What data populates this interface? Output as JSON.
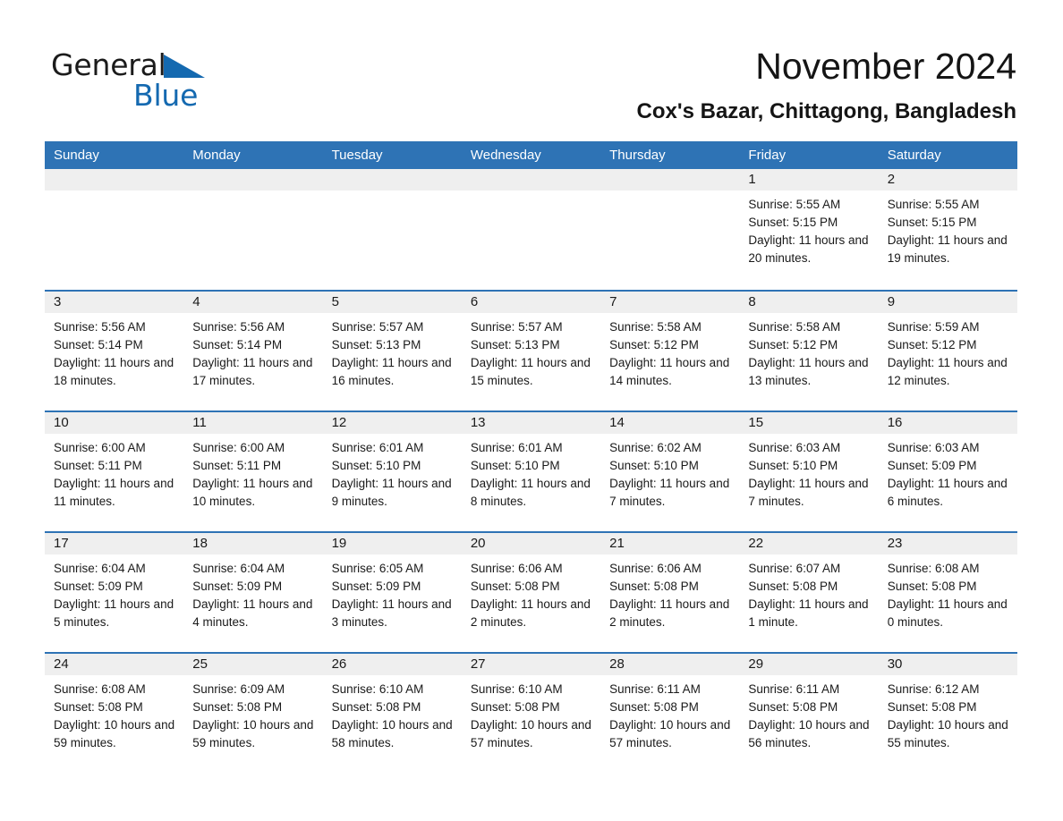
{
  "brand": {
    "name_part1": "General",
    "name_part2": "Blue",
    "triangle_color": "#1469b0"
  },
  "header": {
    "month_title": "November 2024",
    "location": "Cox's Bazar, Chittagong, Bangladesh"
  },
  "colors": {
    "header_blue": "#2e73b5",
    "day_band_gray": "#efefef",
    "text": "#1a1a1a",
    "header_text": "#ffffff"
  },
  "weekdays": [
    "Sunday",
    "Monday",
    "Tuesday",
    "Wednesday",
    "Thursday",
    "Friday",
    "Saturday"
  ],
  "weeks": [
    [
      {
        "day": "",
        "sunrise": "",
        "sunset": "",
        "daylight": ""
      },
      {
        "day": "",
        "sunrise": "",
        "sunset": "",
        "daylight": ""
      },
      {
        "day": "",
        "sunrise": "",
        "sunset": "",
        "daylight": ""
      },
      {
        "day": "",
        "sunrise": "",
        "sunset": "",
        "daylight": ""
      },
      {
        "day": "",
        "sunrise": "",
        "sunset": "",
        "daylight": ""
      },
      {
        "day": "1",
        "sunrise": "Sunrise: 5:55 AM",
        "sunset": "Sunset: 5:15 PM",
        "daylight": "Daylight: 11 hours and 20 minutes."
      },
      {
        "day": "2",
        "sunrise": "Sunrise: 5:55 AM",
        "sunset": "Sunset: 5:15 PM",
        "daylight": "Daylight: 11 hours and 19 minutes."
      }
    ],
    [
      {
        "day": "3",
        "sunrise": "Sunrise: 5:56 AM",
        "sunset": "Sunset: 5:14 PM",
        "daylight": "Daylight: 11 hours and 18 minutes."
      },
      {
        "day": "4",
        "sunrise": "Sunrise: 5:56 AM",
        "sunset": "Sunset: 5:14 PM",
        "daylight": "Daylight: 11 hours and 17 minutes."
      },
      {
        "day": "5",
        "sunrise": "Sunrise: 5:57 AM",
        "sunset": "Sunset: 5:13 PM",
        "daylight": "Daylight: 11 hours and 16 minutes."
      },
      {
        "day": "6",
        "sunrise": "Sunrise: 5:57 AM",
        "sunset": "Sunset: 5:13 PM",
        "daylight": "Daylight: 11 hours and 15 minutes."
      },
      {
        "day": "7",
        "sunrise": "Sunrise: 5:58 AM",
        "sunset": "Sunset: 5:12 PM",
        "daylight": "Daylight: 11 hours and 14 minutes."
      },
      {
        "day": "8",
        "sunrise": "Sunrise: 5:58 AM",
        "sunset": "Sunset: 5:12 PM",
        "daylight": "Daylight: 11 hours and 13 minutes."
      },
      {
        "day": "9",
        "sunrise": "Sunrise: 5:59 AM",
        "sunset": "Sunset: 5:12 PM",
        "daylight": "Daylight: 11 hours and 12 minutes."
      }
    ],
    [
      {
        "day": "10",
        "sunrise": "Sunrise: 6:00 AM",
        "sunset": "Sunset: 5:11 PM",
        "daylight": "Daylight: 11 hours and 11 minutes."
      },
      {
        "day": "11",
        "sunrise": "Sunrise: 6:00 AM",
        "sunset": "Sunset: 5:11 PM",
        "daylight": "Daylight: 11 hours and 10 minutes."
      },
      {
        "day": "12",
        "sunrise": "Sunrise: 6:01 AM",
        "sunset": "Sunset: 5:10 PM",
        "daylight": "Daylight: 11 hours and 9 minutes."
      },
      {
        "day": "13",
        "sunrise": "Sunrise: 6:01 AM",
        "sunset": "Sunset: 5:10 PM",
        "daylight": "Daylight: 11 hours and 8 minutes."
      },
      {
        "day": "14",
        "sunrise": "Sunrise: 6:02 AM",
        "sunset": "Sunset: 5:10 PM",
        "daylight": "Daylight: 11 hours and 7 minutes."
      },
      {
        "day": "15",
        "sunrise": "Sunrise: 6:03 AM",
        "sunset": "Sunset: 5:10 PM",
        "daylight": "Daylight: 11 hours and 7 minutes."
      },
      {
        "day": "16",
        "sunrise": "Sunrise: 6:03 AM",
        "sunset": "Sunset: 5:09 PM",
        "daylight": "Daylight: 11 hours and 6 minutes."
      }
    ],
    [
      {
        "day": "17",
        "sunrise": "Sunrise: 6:04 AM",
        "sunset": "Sunset: 5:09 PM",
        "daylight": "Daylight: 11 hours and 5 minutes."
      },
      {
        "day": "18",
        "sunrise": "Sunrise: 6:04 AM",
        "sunset": "Sunset: 5:09 PM",
        "daylight": "Daylight: 11 hours and 4 minutes."
      },
      {
        "day": "19",
        "sunrise": "Sunrise: 6:05 AM",
        "sunset": "Sunset: 5:09 PM",
        "daylight": "Daylight: 11 hours and 3 minutes."
      },
      {
        "day": "20",
        "sunrise": "Sunrise: 6:06 AM",
        "sunset": "Sunset: 5:08 PM",
        "daylight": "Daylight: 11 hours and 2 minutes."
      },
      {
        "day": "21",
        "sunrise": "Sunrise: 6:06 AM",
        "sunset": "Sunset: 5:08 PM",
        "daylight": "Daylight: 11 hours and 2 minutes."
      },
      {
        "day": "22",
        "sunrise": "Sunrise: 6:07 AM",
        "sunset": "Sunset: 5:08 PM",
        "daylight": "Daylight: 11 hours and 1 minute."
      },
      {
        "day": "23",
        "sunrise": "Sunrise: 6:08 AM",
        "sunset": "Sunset: 5:08 PM",
        "daylight": "Daylight: 11 hours and 0 minutes."
      }
    ],
    [
      {
        "day": "24",
        "sunrise": "Sunrise: 6:08 AM",
        "sunset": "Sunset: 5:08 PM",
        "daylight": "Daylight: 10 hours and 59 minutes."
      },
      {
        "day": "25",
        "sunrise": "Sunrise: 6:09 AM",
        "sunset": "Sunset: 5:08 PM",
        "daylight": "Daylight: 10 hours and 59 minutes."
      },
      {
        "day": "26",
        "sunrise": "Sunrise: 6:10 AM",
        "sunset": "Sunset: 5:08 PM",
        "daylight": "Daylight: 10 hours and 58 minutes."
      },
      {
        "day": "27",
        "sunrise": "Sunrise: 6:10 AM",
        "sunset": "Sunset: 5:08 PM",
        "daylight": "Daylight: 10 hours and 57 minutes."
      },
      {
        "day": "28",
        "sunrise": "Sunrise: 6:11 AM",
        "sunset": "Sunset: 5:08 PM",
        "daylight": "Daylight: 10 hours and 57 minutes."
      },
      {
        "day": "29",
        "sunrise": "Sunrise: 6:11 AM",
        "sunset": "Sunset: 5:08 PM",
        "daylight": "Daylight: 10 hours and 56 minutes."
      },
      {
        "day": "30",
        "sunrise": "Sunrise: 6:12 AM",
        "sunset": "Sunset: 5:08 PM",
        "daylight": "Daylight: 10 hours and 55 minutes."
      }
    ]
  ]
}
